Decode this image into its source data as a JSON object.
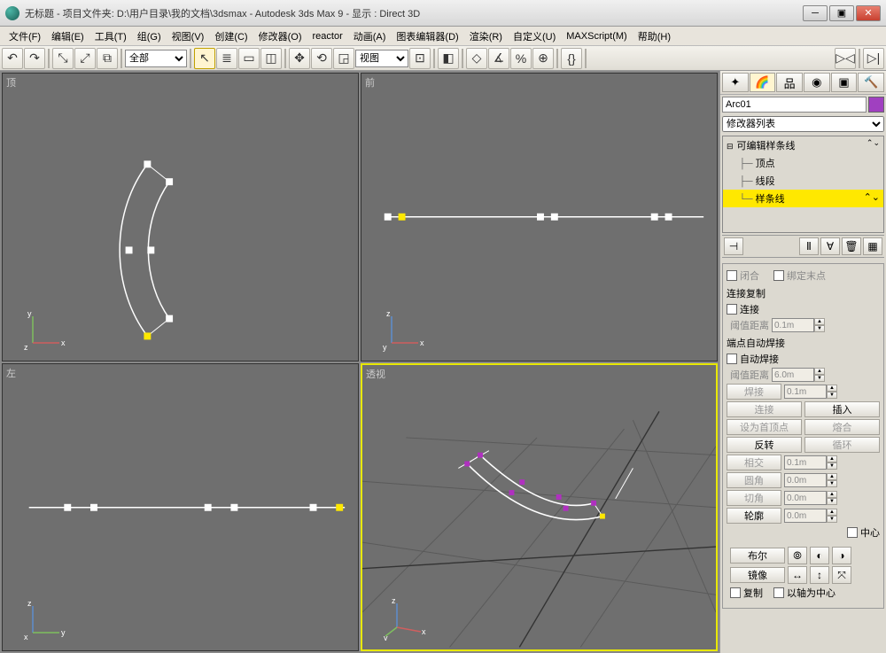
{
  "window": {
    "title": "无标题    - 项目文件夹: D:\\用户目录\\我的文档\\3dsmax      - Autodesk 3ds Max 9      - 显示 : Direct 3D"
  },
  "menu": [
    "文件(F)",
    "编辑(E)",
    "工具(T)",
    "组(G)",
    "视图(V)",
    "创建(C)",
    "修改器(O)",
    "reactor",
    "动画(A)",
    "图表编辑器(D)",
    "渲染(R)",
    "自定义(U)",
    "MAXScript(M)",
    "帮助(H)"
  ],
  "toolbar": {
    "scope": "全部",
    "coord": "视图"
  },
  "viewport": {
    "top": "顶",
    "front": "前",
    "left": "左",
    "persp": "透视"
  },
  "object": {
    "name": "Arc01"
  },
  "modlist_placeholder": "修改器列表",
  "stack": {
    "parent": "可编辑样条线",
    "sub1": "顶点",
    "sub2": "线段",
    "sub3": "样条线"
  },
  "geom": {
    "closed": "闭合",
    "bind_end": "绑定末点",
    "connect_copy": "连接复制",
    "connect": "连接",
    "threshold": "阈值距离",
    "threshold_val": "0.1m",
    "autoweld_hdr": "端点自动焊接",
    "autoweld": "自动焊接",
    "autoweld_th": "阈值距离",
    "autoweld_val": "6.0m",
    "weld": "焊接",
    "weld_val": "0.1m",
    "attach": "连接",
    "insert": "插入",
    "makefirst": "设为首顶点",
    "fuse": "熔合",
    "reverse": "反转",
    "cycle": "循环",
    "cross": "相交",
    "cross_val": "0.1m",
    "fillet": "圆角",
    "fillet_val": "0.0m",
    "chamfer": "切角",
    "chamfer_val": "0.0m",
    "outline": "轮廓",
    "outline_val": "0.0m",
    "center": "中心",
    "boolean": "布尔",
    "mirror": "镜像",
    "copy": "复制",
    "axis_center": "以轴为中心"
  }
}
